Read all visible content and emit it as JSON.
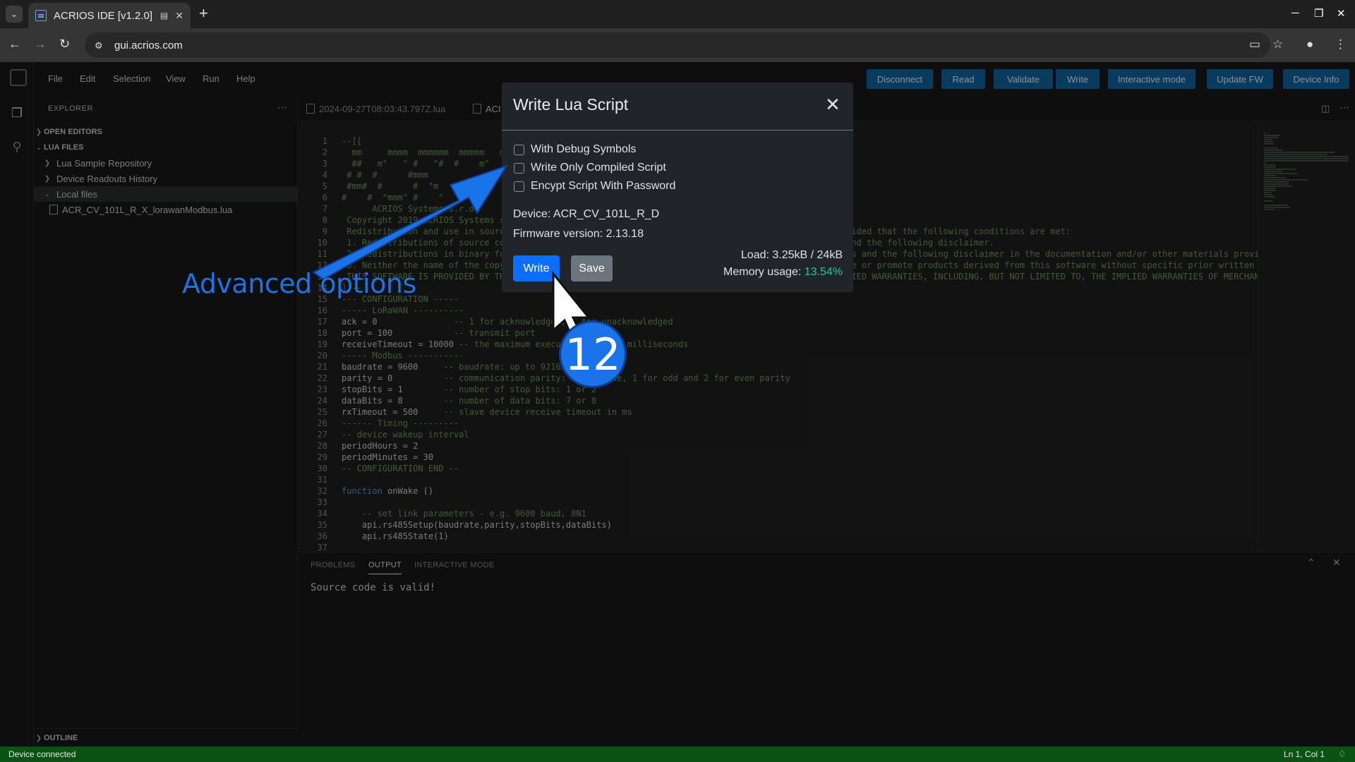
{
  "browser": {
    "tab_title": "ACRIOS IDE [v1.2.0]",
    "url": "gui.acrios.com"
  },
  "menu": [
    "File",
    "Edit",
    "Selection",
    "View",
    "Run",
    "Help"
  ],
  "toolbar": [
    "Disconnect",
    "Read",
    "Validate",
    "Write",
    "Interactive mode",
    "Update FW",
    "Device Info"
  ],
  "sidebar": {
    "title": "EXPLORER",
    "open_editors": "OPEN EDITORS",
    "lua_files": "LUA FILES",
    "items": [
      "Lua Sample Repository",
      "Device Readouts History",
      "Local files"
    ],
    "file": "ACR_CV_101L_R_X_lorawanModbus.lua",
    "outline": "OUTLINE"
  },
  "editor_tabs": [
    "2024-09-27T08:03:43.797Z.lua",
    "ACI"
  ],
  "code_lines": [
    "--[[",
    "  mm     mmmm  mmmmmm  mmmmm   mm",
    "  ##   m\"   \" #   \"#  #    m\"",
    " # #  #      #mmm",
    " #mm#  #      #  \"m",
    "#    #  \"mmm\" #    \"",
    "",
    "      ACRIOS Systems s.r.o.",
    " Copyright 2019 ACRIOS Systems s.r.o.",
    " Redistribution and use in source and binary forms, with or without modification, are permitted provided that the following conditions are met:",
    " 1. Redistributions of source code must retain the above copyright notice, this list of conditions and the following disclaimer.",
    " 2. Redistributions in binary form must reproduce the above copyright notice, this list of conditions and the following disclaimer in the documentation and/or other materials provid",
    " 3. Neither the name of the copyright holder nor the names of its contributors may be used to endorse or promote products derived from this software without specific prior written p",
    " THIS SOFTWARE IS PROVIDED BY THE COPYRIGHT HOLDERS AND CONTRIBUTORS \"AS IS\" AND ANY EXPRESS OR IMPLIED WARRANTIES, INCLUDING, BUT NOT LIMITED TO, THE IMPLIED WARRANTIES OF MERCHANT",
    "]]--",
    "--- CONFIGURATION -----",
    "----- LoRaWAN ----------",
    "ack = 0               -- 1 for acknowledged, 0 for unacknowledged",
    "port = 100            -- transmit port",
    "receiveTimeout = 10000 -- the maximum execution time in milliseconds",
    "----- Modbus -----------",
    "baudrate = 9600     -- baudrate: up to 921600",
    "parity = 0          -- communication parity: 0 for none, 1 for odd and 2 for even parity",
    "stopBits = 1        -- number of stop bits: 1 or 2",
    "dataBits = 8        -- number of data bits: 7 or 8",
    "rxTimeout = 500     -- slave device receive timeout in ms",
    "------ Timing ---------",
    "-- device wakeup interval",
    "periodHours = 2",
    "periodMinutes = 30",
    "-- CONFIGURATION END --",
    "",
    "function onWake ()",
    "",
    "    -- set link parameters - e.g. 9600 baud, 8N1",
    "    api.rs485Setup(baudrate,parity,stopBits,dataBits)",
    "    api.rs485State(1)"
  ],
  "panel": {
    "tabs": [
      "PROBLEMS",
      "OUTPUT",
      "INTERACTIVE MODE"
    ],
    "output": "Source code is valid!"
  },
  "status": {
    "left": "Device connected",
    "right": "Ln 1, Col 1"
  },
  "modal": {
    "title": "Write Lua Script",
    "options": [
      "With Debug Symbols",
      "Write Only Compiled Script",
      "Encypt Script With Password"
    ],
    "device": "Device: ACR_CV_101L_R_D",
    "firmware": "Firmware version: 2.13.18",
    "write": "Write",
    "save": "Save",
    "load": "Load: 3.25kB / 24kB",
    "memory_label": "Memory usage: ",
    "memory_value": "13.54%"
  },
  "annotation": {
    "text": "Advanced options",
    "step": "12",
    "color": "#1a73e8"
  }
}
